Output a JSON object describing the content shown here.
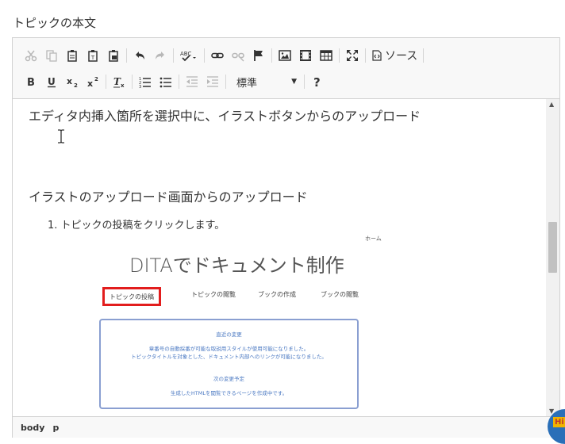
{
  "field_label": "トピックの本文",
  "toolbar": {
    "source_label": "ソース",
    "format_combo_value": "標準"
  },
  "content": {
    "paragraph1": "エディタ内挿入箇所を選択中に、イラストボタンからのアップロード",
    "paragraph2": "イラストのアップロード画面からのアップロード",
    "list_item1": "1. トピックの投稿をクリックします。"
  },
  "embedded_screenshot": {
    "home_link": "ホーム",
    "title": "DITAでドキュメント制作",
    "nav": [
      "トピックの投稿",
      "トピックの閲覧",
      "ブックの作成",
      "ブックの閲覧"
    ],
    "box_heading1": "直近の変更",
    "box_line1": "章番号の自動採番が可能な取説用スタイルが使用可能になりました。",
    "box_line2": "トピックタイトルを対象とした、ドキュメント内部へのリンクが可能になりました。",
    "box_heading2": "次の変更予定",
    "box_line3": "生成したHTMLを閲覧できるページを作成中です。"
  },
  "statusbar": {
    "crumbs": [
      "body",
      "p"
    ]
  },
  "help_badge": "Hi",
  "colors": {
    "highlight_red": "#e21d1d",
    "box_border": "#8a9fd1",
    "box_text": "#4a78c2",
    "badge_blue": "#2a6fb8"
  }
}
